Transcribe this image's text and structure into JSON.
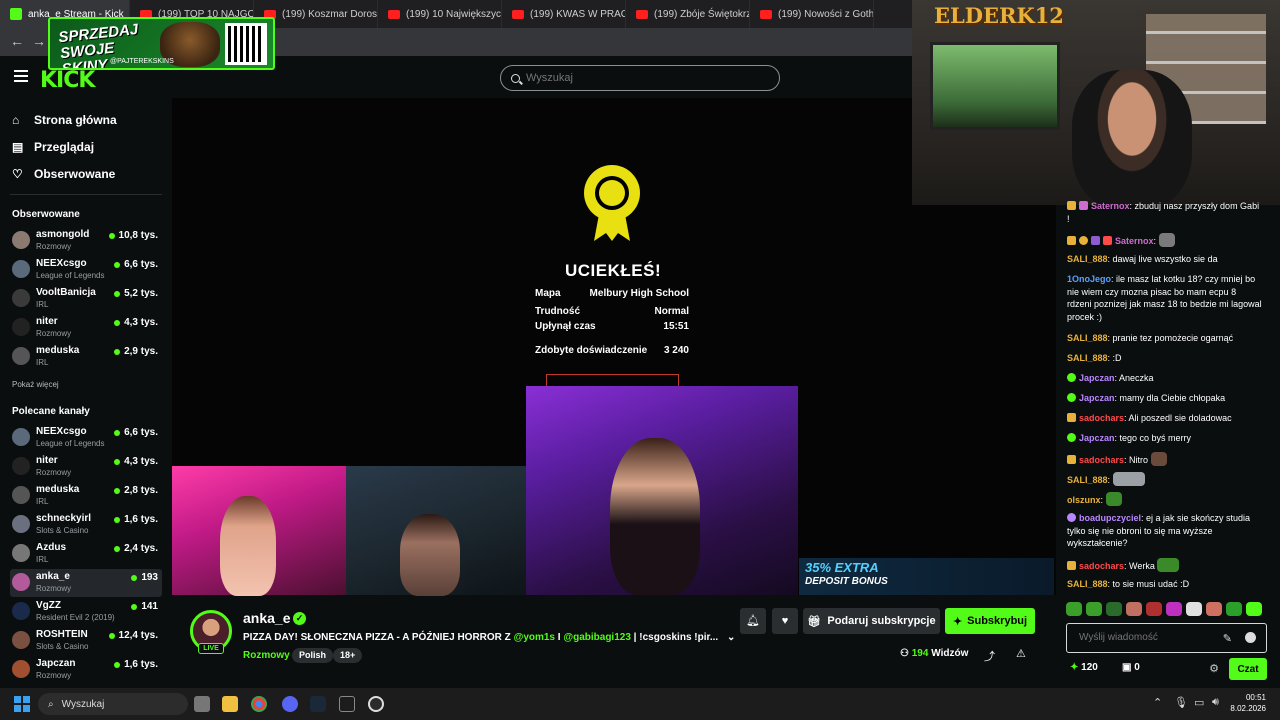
{
  "browser": {
    "tabs": [
      {
        "label": "anka_e Stream - Kick",
        "active": true
      },
      {
        "label": "(199) TOP 10 NAJGORSZYCH"
      },
      {
        "label": "(199) Koszmar Dorosłych"
      },
      {
        "label": "(199) 10 Największych"
      },
      {
        "label": "(199) KWAS W PRACY"
      },
      {
        "label": "(199) Zbóje Świętokrz"
      },
      {
        "label": "(199) Nowości z Goth"
      }
    ]
  },
  "promo": {
    "text": "SPRZEDAJ SWOJE SKINY",
    "handle": "@PAJTEREKSKINS"
  },
  "webcam": {
    "logo": "ELDERK12"
  },
  "header": {
    "search_placeholder": "Wyszukaj"
  },
  "sidebar": {
    "nav": [
      {
        "label": "Strona główna",
        "icon": "home-icon"
      },
      {
        "label": "Przeglądaj",
        "icon": "browse-icon"
      },
      {
        "label": "Obserwowane",
        "icon": "heart-icon"
      }
    ],
    "followed_title": "Obserwowane",
    "followed": [
      {
        "name": "asmongold",
        "category": "Rozmowy",
        "viewers": "10,8 tys."
      },
      {
        "name": "NEEXcsgo",
        "category": "League of Legends",
        "viewers": "6,6 tys."
      },
      {
        "name": "VooltBanicja",
        "category": "IRL",
        "viewers": "5,2 tys."
      },
      {
        "name": "niter",
        "category": "Rozmowy",
        "viewers": "4,3 tys."
      },
      {
        "name": "meduska",
        "category": "IRL",
        "viewers": "2,9 tys."
      }
    ],
    "show_more": "Pokaż więcej",
    "recommended_title": "Polecane kanały",
    "recommended": [
      {
        "name": "NEEXcsgo",
        "category": "League of Legends",
        "viewers": "6,6 tys."
      },
      {
        "name": "niter",
        "category": "Rozmowy",
        "viewers": "4,3 tys."
      },
      {
        "name": "meduska",
        "category": "IRL",
        "viewers": "2,8 tys."
      },
      {
        "name": "schneckyirl",
        "category": "Slots & Casino",
        "viewers": "1,6 tys."
      },
      {
        "name": "Azdus",
        "category": "IRL",
        "viewers": "2,4 tys."
      },
      {
        "name": "anka_e",
        "category": "Rozmowy",
        "viewers": "193"
      },
      {
        "name": "VgZZ",
        "category": "Resident Evil 2 (2019)",
        "viewers": "141"
      },
      {
        "name": "ROSHTEIN",
        "category": "Slots & Casino",
        "viewers": "12,4 tys."
      },
      {
        "name": "Japczan",
        "category": "Rozmowy",
        "viewers": "1,6 tys."
      }
    ]
  },
  "endgame": {
    "title": "UCIEKŁEŚ!",
    "rows": [
      {
        "label": "Mapa",
        "value": "Melbury High School"
      },
      {
        "label": "Trudność",
        "value": "Normal"
      },
      {
        "label": "Upłynął czas",
        "value": "15:51"
      },
      {
        "label": "Zdobyte doświadczenie",
        "value": "3 240"
      }
    ]
  },
  "ad": {
    "line1": "35% EXTRA",
    "line2": "DEPOSIT BONUS"
  },
  "stream": {
    "name": "anka_e",
    "live": "LIVE",
    "title_prefix": "PIZZA DAY! SŁONECZNA PIZZA - A PÓŹNIEJ HORROR Z ",
    "mention1": "@yom1s",
    "title_mid": " I ",
    "mention2": "@gabibagi123",
    "title_suffix": " | !csgoskins !pir...",
    "category": "Rozmowy",
    "tags": [
      "Polish",
      "18+"
    ],
    "gift_label": "Podaruj subskrypcje",
    "subscribe_label": "Subskrybuj",
    "viewers_count": "194",
    "viewers_label": "Widzów"
  },
  "chat": {
    "messages": [
      {
        "user": "Saternox",
        "color": "#d06bd0",
        "text": ": zbuduj nasz przyszły dom Gabi !"
      },
      {
        "user": "Saternox",
        "color": "#d06bd0",
        "text": ":"
      },
      {
        "user": "SALI_888",
        "color": "#e8b23a",
        "text": ": dawaj live wszystko sie da"
      },
      {
        "user": "1OnoJego",
        "color": "#5aa0ff",
        "text": ": ile masz lat kotku 18? czy mniej bo nie wiem czy mozna pisac bo mam ecpu 8 rdzeni poznizej jak masz 18 to bedzie mi lagowal procek :)"
      },
      {
        "user": "SALI_888",
        "color": "#e8b23a",
        "text": ": pranie tez pomożecie ogarnąć"
      },
      {
        "user": "SALI_888",
        "color": "#e8b23a",
        "text": ": :D"
      },
      {
        "user": "Japczan",
        "color": "#b887ff",
        "text": ": Aneczka"
      },
      {
        "user": "Japczan",
        "color": "#b887ff",
        "text": ": mamy dla Ciebie chłopaka"
      },
      {
        "user": "sadochars",
        "color": "#ff4a4a",
        "text": ": Ali poszedl sie doladowac"
      },
      {
        "user": "Japczan",
        "color": "#b887ff",
        "text": ": tego co byś merry"
      },
      {
        "user": "sadochars",
        "color": "#ff4a4a",
        "text": ": Nitro"
      },
      {
        "user": "SALI_888",
        "color": "#e8b23a",
        "text": ":"
      },
      {
        "user": "olszunx",
        "color": "#e8b23a",
        "text": ":"
      },
      {
        "user": "boadupczyciel",
        "color": "#b887ff",
        "text": ": ej a jak sie skończy studia tylko się nie obroni to się ma wyższe wykształcenie?"
      },
      {
        "user": "sadochars",
        "color": "#ff4a4a",
        "text": ": Werka"
      },
      {
        "user": "SALI_888",
        "color": "#e8b23a",
        "text": ": to sie musi udać :D"
      }
    ],
    "input_placeholder": "Wyślij wiadomość",
    "points": "120",
    "gifts": "0",
    "send_label": "Czat"
  },
  "taskbar": {
    "search_placeholder": "Wyszukaj",
    "time": "00:51",
    "date": "8.02.2026"
  }
}
